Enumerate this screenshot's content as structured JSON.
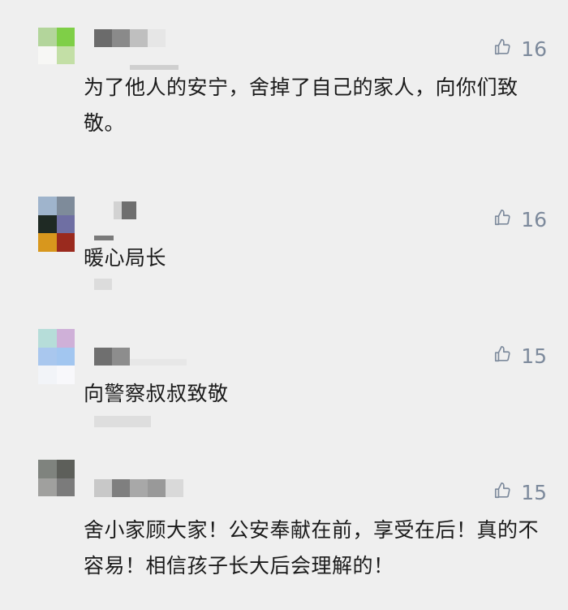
{
  "comments": [
    {
      "avatar_colors": [
        "#b3d59b",
        "#7fcf47",
        "#f7f7f5",
        "#c3dfa6"
      ],
      "likes": "16",
      "text": "为了他人的安宁，舍掉了自己的家人，向你们致敬。"
    },
    {
      "avatar_colors": [
        "#9fb4cc",
        "#7e8b9a",
        "#1f2a24",
        "#6f6fa3",
        "#d8971d",
        "#9a2a1e"
      ],
      "likes": "16",
      "text": "暖心局长"
    },
    {
      "avatar_colors": [
        "#b6ddd9",
        "#cfb0d8",
        "#a9c7ee",
        "#a2c6f0",
        "#f2f4f8",
        "#f8f8fb"
      ],
      "likes": "15",
      "text": "向警察叔叔致敬"
    },
    {
      "avatar_colors": [
        "#7f837e",
        "#5d5f5a",
        "#a0a09e",
        "#7b7b7b"
      ],
      "likes": "15",
      "text": "舍小家顾大家！公安奉献在前，享受在后！真的不容易！相信孩子长大后会理解的！"
    }
  ],
  "icons": {
    "like": "thumbs-up-icon"
  },
  "colors": {
    "background": "#efefef",
    "like_color": "#7d8a9c",
    "text_color": "#1b1b1b"
  }
}
